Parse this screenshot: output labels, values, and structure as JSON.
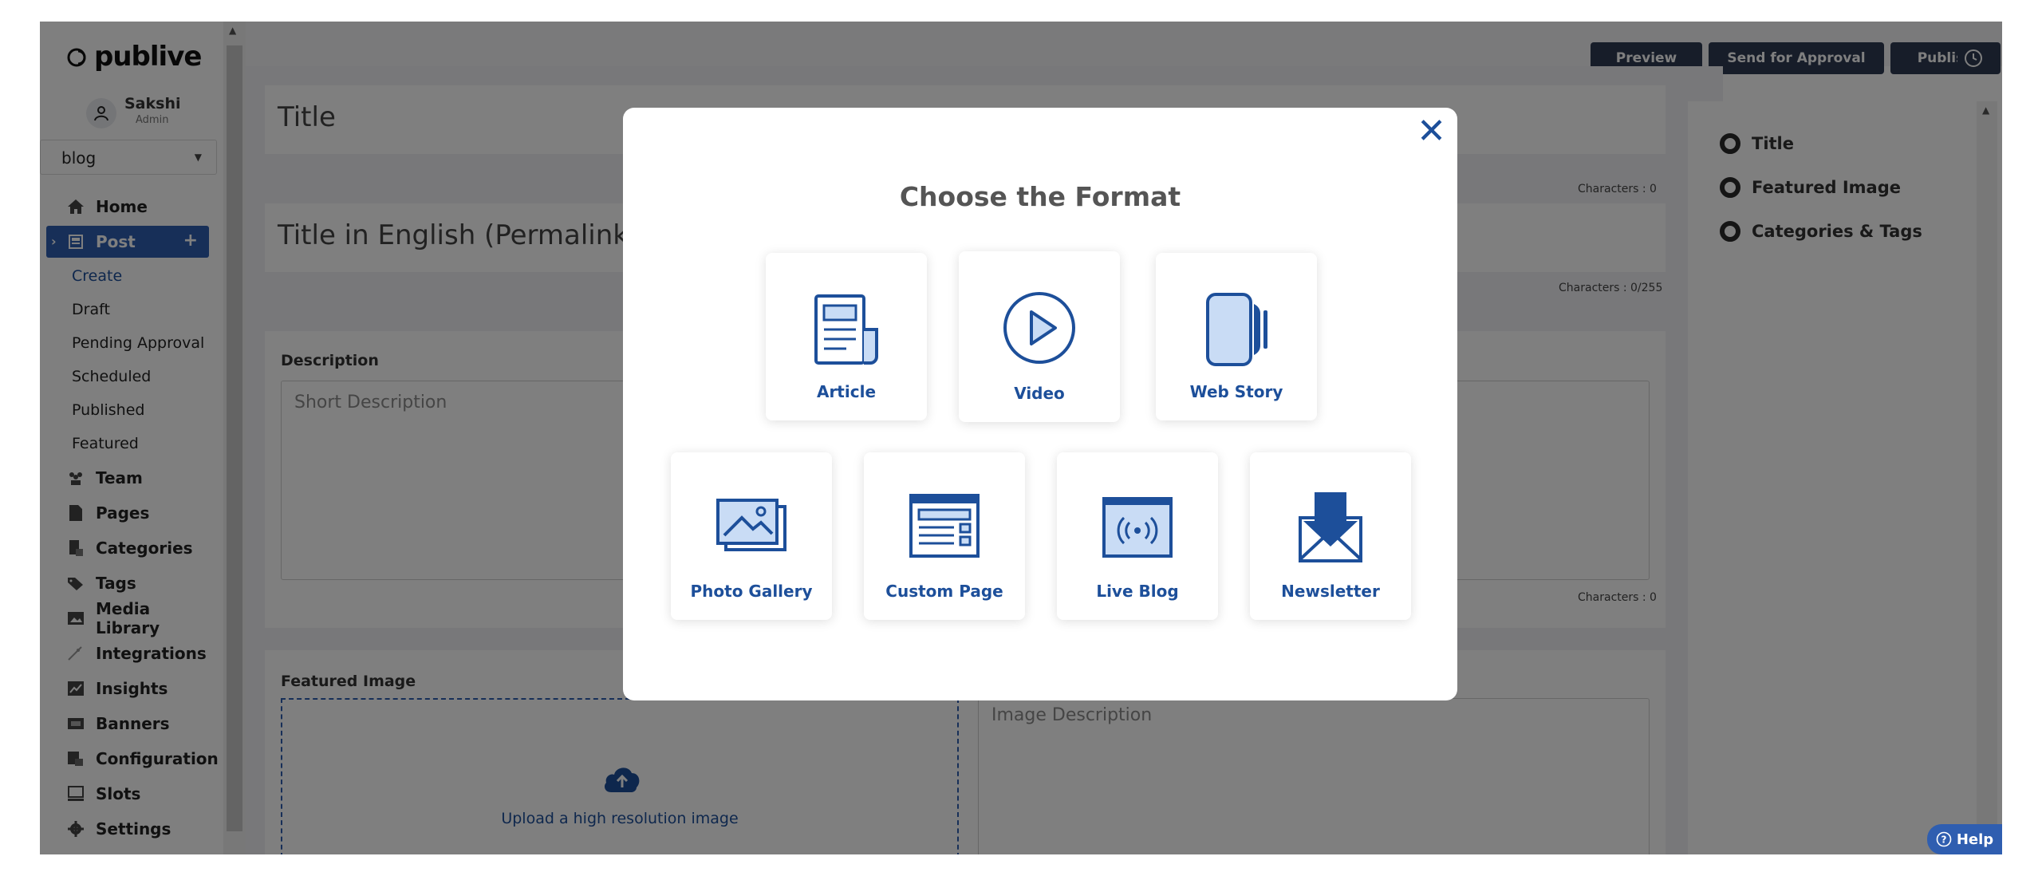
{
  "brand": {
    "name": "publive"
  },
  "user": {
    "name": "Sakshi",
    "role": "Admin"
  },
  "site_select": {
    "value": "blog"
  },
  "nav": {
    "home": "Home",
    "post": "Post",
    "sub": [
      "Create",
      "Draft",
      "Pending Approval",
      "Scheduled",
      "Published",
      "Featured"
    ],
    "team": "Team",
    "pages": "Pages",
    "categories": "Categories",
    "tags": "Tags",
    "media_library": "Media Library",
    "integrations": "Integrations",
    "insights": "Insights",
    "banners": "Banners",
    "configuration": "Configuration",
    "slots": "Slots",
    "settings": "Settings"
  },
  "toolbar": {
    "preview": "Preview",
    "send_for_approval": "Send for Approval",
    "publish": "Publish"
  },
  "editor": {
    "title_placeholder": "Title",
    "title_counter": "Characters : 0",
    "permalink_placeholder": "Title in English (Permalink)",
    "permalink_counter": "Characters : 0/255",
    "description_label": "Description",
    "description_placeholder": "Short Description",
    "description_counter": "Characters : 0",
    "featured_image_label": "Featured Image",
    "upload_text": "Upload a high resolution image",
    "image_description_placeholder": "Image Description"
  },
  "right_panel": {
    "items": [
      "Title",
      "Featured Image",
      "Categories & Tags"
    ]
  },
  "help": {
    "label": "Help"
  },
  "modal": {
    "title": "Choose the Format",
    "close": "✕",
    "formats": [
      "Article",
      "Video",
      "Web Story",
      "Photo Gallery",
      "Custom Page",
      "Live Blog",
      "Newsletter"
    ]
  },
  "colors": {
    "primary": "#1d4f9a",
    "accent_blue": "#2f5eb0",
    "dark_button": "#2f3a52"
  }
}
